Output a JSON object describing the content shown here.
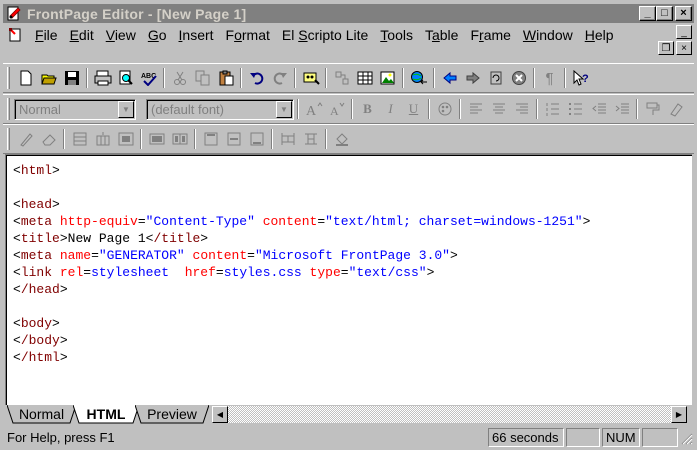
{
  "window": {
    "title": "FrontPage Editor - [New Page 1]",
    "minimize_glyph": "_",
    "maximize_glyph": "□",
    "close_glyph": "×",
    "restore_glyph": "❐"
  },
  "menu": {
    "items": [
      {
        "label": "File",
        "access": "F"
      },
      {
        "label": "Edit",
        "access": "E"
      },
      {
        "label": "View",
        "access": "V"
      },
      {
        "label": "Go",
        "access": "G"
      },
      {
        "label": "Insert",
        "access": "I"
      },
      {
        "label": "Format",
        "access": "o"
      },
      {
        "label": "El Scripto Lite",
        "access": "S"
      },
      {
        "label": "Tools",
        "access": "T"
      },
      {
        "label": "Table",
        "access": "a"
      },
      {
        "label": "Frame",
        "access": "r"
      },
      {
        "label": "Window",
        "access": "W"
      },
      {
        "label": "Help",
        "access": "H"
      }
    ]
  },
  "format_toolbar": {
    "style_value": "Normal",
    "font_value": "(default font)"
  },
  "icons": {
    "standard": [
      "new-page-icon",
      "open-icon",
      "save-icon",
      "print-icon",
      "print-preview-icon",
      "spelling-icon",
      "cut-icon",
      "copy-icon",
      "paste-icon",
      "undo-icon",
      "redo-icon",
      "webbot-icon",
      "insert-component-icon",
      "insert-table-icon",
      "insert-image-icon",
      "hyperlink-icon",
      "back-icon",
      "forward-icon",
      "refresh-icon",
      "stop-icon",
      "show-all-icon",
      "help-icon"
    ],
    "format": [
      "increase-font-icon",
      "decrease-font-icon",
      "bold-icon",
      "italic-icon",
      "underline-icon",
      "text-color-icon",
      "align-left-icon",
      "align-center-icon",
      "align-right-icon",
      "numbered-list-icon",
      "bulleted-list-icon",
      "decrease-indent-icon",
      "increase-indent-icon",
      "format-painter-icon",
      "clear-format-icon"
    ],
    "table": [
      "draw-table-icon",
      "eraser-icon",
      "insert-rows-icon",
      "insert-columns-icon",
      "insert-cell-icon",
      "merge-cells-icon",
      "split-cells-icon",
      "align-top-icon",
      "center-vertically-icon",
      "align-bottom-icon",
      "distribute-rows-icon",
      "distribute-columns-icon",
      "fill-color-icon"
    ]
  },
  "code": {
    "lines": [
      "<html>",
      "",
      "<head>",
      "<meta http-equiv=\"Content-Type\" content=\"text/html; charset=windows-1251\">",
      "<title>New Page 1</title>",
      "<meta name=\"GENERATOR\" content=\"Microsoft FrontPage 3.0\">",
      "<link rel=stylesheet  href=styles.css type=\"text/css\">",
      "</head>",
      "",
      "<body>",
      "</body>",
      "</html>"
    ]
  },
  "tabs": [
    {
      "label": "Normal",
      "active": false
    },
    {
      "label": "HTML",
      "active": true
    },
    {
      "label": "Preview",
      "active": false
    }
  ],
  "status": {
    "help_text": "For Help, press F1",
    "timer": "66 seconds",
    "num": "NUM"
  }
}
